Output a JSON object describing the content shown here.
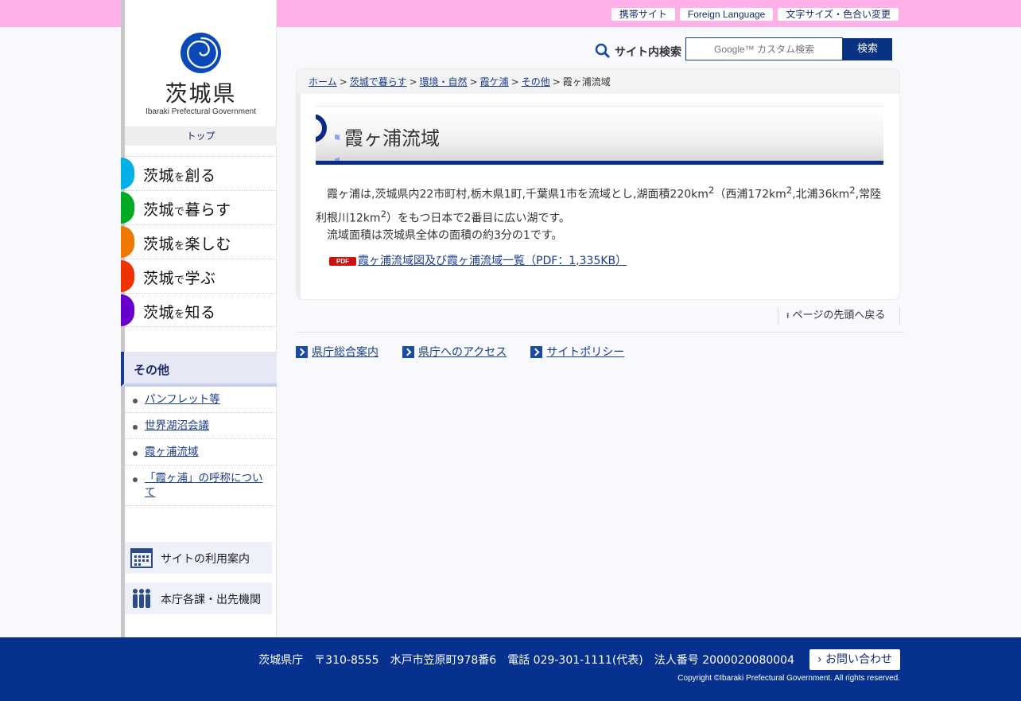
{
  "header": {
    "links": [
      "携帯サイト",
      "Foreign Language",
      "文字サイズ・色合い変更"
    ]
  },
  "logo": {
    "name": "茨城県",
    "sub": "Ibaraki Prefectural Government",
    "top_link": "トップ"
  },
  "nav": [
    {
      "label_a": "茨城",
      "label_particle": "を",
      "label_b": "創る",
      "color": "#00b0e8"
    },
    {
      "label_a": "茨城",
      "label_particle": "で",
      "label_b": "暮らす",
      "color": "#00aa22"
    },
    {
      "label_a": "茨城",
      "label_particle": "を",
      "label_b": "楽しむ",
      "color": "#f07800"
    },
    {
      "label_a": "茨城",
      "label_particle": "で",
      "label_b": "学ぶ",
      "color": "#ee3300"
    },
    {
      "label_a": "茨城",
      "label_particle": "を",
      "label_b": "知る",
      "color": "#6a00cc"
    }
  ],
  "section": {
    "title": "その他",
    "items": [
      "パンフレット等",
      "世界湖沼会議",
      "霞ヶ浦流域",
      "「霞ヶ浦」の呼称について"
    ]
  },
  "sidebar_buttons": {
    "guide": "サイトの利用案内",
    "offices": "本庁各課・出先機関"
  },
  "search": {
    "label": "サイト内検索",
    "placeholder": "Google™ カスタム検索",
    "button": "検索"
  },
  "breadcrumb": [
    "ホーム",
    "茨城で暮らす",
    "環境・自然",
    "霞ケ浦",
    "その他",
    "霞ヶ浦流域"
  ],
  "page": {
    "title": "霞ヶ浦流域",
    "p1_a": "霞ヶ浦は,茨城県内22市町村,栃木県1町,千葉県1市を流域とし,湖面積220km",
    "p1_b": "（西浦172km",
    "p1_c": ",北浦36km",
    "p1_d": ",常陸利根川12km",
    "p1_e": "）をもつ日本で2番目に広い湖です。",
    "sup": "2",
    "p2": "流域面積は茨城県全体の面積の約3分の1です。",
    "pdf_badge": "PDF",
    "pdf_link": "霞ヶ浦流域図及び霞ヶ浦流域一覧（PDF：1,335KB）"
  },
  "pagetop": "ページの先頭へ戻る",
  "footer_links": [
    "県庁総合案内",
    "県庁へのアクセス",
    "サイトポリシー"
  ],
  "footer": {
    "address": "茨城県庁　〒310-8555　水戸市笠原町978番6　電話 029-301-1111(代表)　法人番号 2000020080004",
    "contact": "お問い合わせ",
    "copyright": "Copyright ©Ibaraki Prefectural Government. All rights reserved."
  },
  "colors": {
    "accent": "#06318e",
    "topbar": "#ffb0e8"
  }
}
